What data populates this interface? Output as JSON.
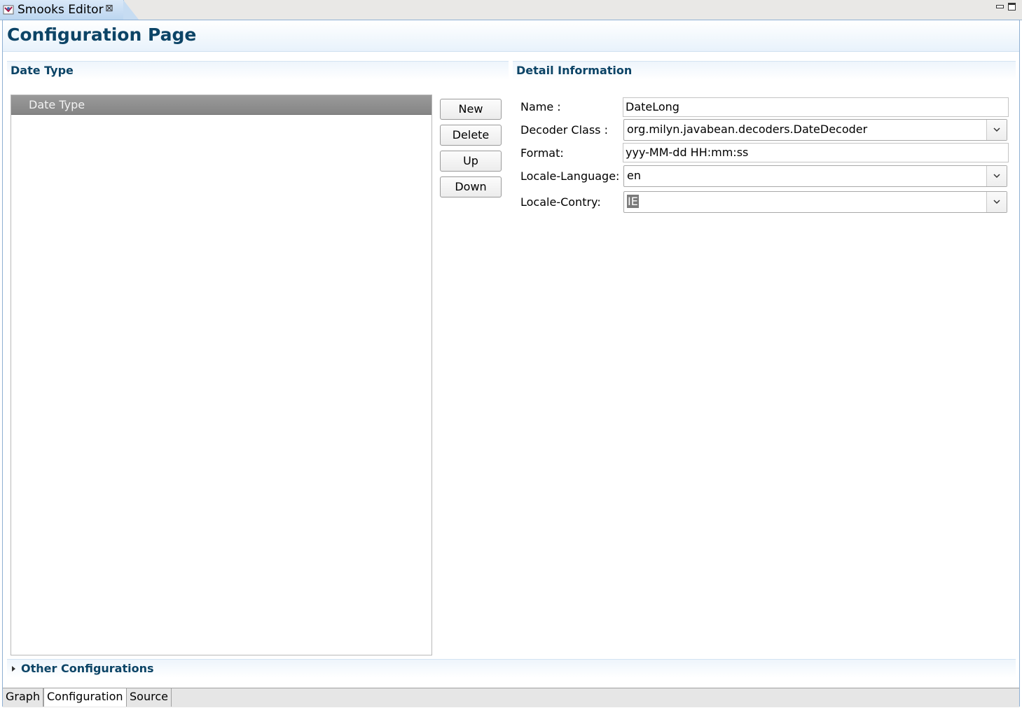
{
  "editor_tab": {
    "title": "Smooks Editor",
    "close": "⊠"
  },
  "page": {
    "title": "Configuration Page"
  },
  "left_section": {
    "title": "Date Type",
    "list_header": "Date Type",
    "buttons": {
      "new": "New",
      "delete": "Delete",
      "up": "Up",
      "down": "Down"
    }
  },
  "detail": {
    "title": "Detail Information",
    "name_label": "Name :",
    "name_value": "DateLong",
    "decoder_label": "Decoder Class :",
    "decoder_value": "org.milyn.javabean.decoders.DateDecoder",
    "format_label": "Format:",
    "format_value": "yyy-MM-dd HH:mm:ss",
    "language_label": "Locale-Language:",
    "language_value": "en",
    "country_label": "Locale-Contry:",
    "country_value": "IE"
  },
  "other_section": {
    "title": "Other Configurations"
  },
  "bottom_tabs": [
    "Graph",
    "Configuration",
    "Source"
  ]
}
